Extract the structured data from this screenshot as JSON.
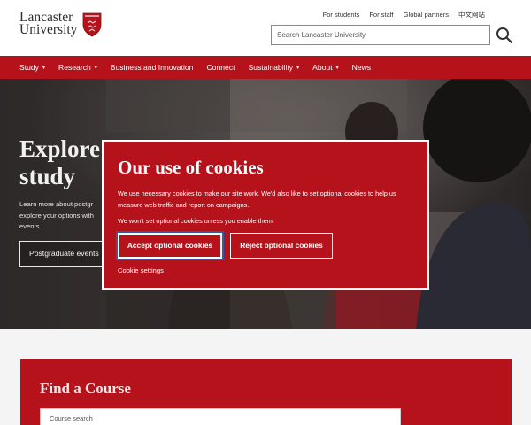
{
  "header": {
    "logo_line1": "Lancaster",
    "logo_line2": "University",
    "utility_links": [
      "For students",
      "For staff",
      "Global partners",
      "中文网站"
    ],
    "search_placeholder": "Search Lancaster University",
    "search_icon": "search-icon"
  },
  "nav": {
    "items": [
      {
        "label": "Study",
        "has_dropdown": true
      },
      {
        "label": "Research",
        "has_dropdown": true
      },
      {
        "label": "Business and Innovation",
        "has_dropdown": false
      },
      {
        "label": "Connect",
        "has_dropdown": false
      },
      {
        "label": "Sustainability",
        "has_dropdown": true
      },
      {
        "label": "About",
        "has_dropdown": true
      },
      {
        "label": "News",
        "has_dropdown": false
      }
    ],
    "caret": "▾"
  },
  "hero": {
    "title_line1": "Explore",
    "title_line2": "study",
    "desc_line1": "Learn more about postgr",
    "desc_line2": "explore your options with",
    "desc_line3": "events.",
    "button_label": "Postgraduate events"
  },
  "cookie_banner": {
    "title": "Our use of cookies",
    "paragraph1_line1": "We use necessary cookies to make our site work. We'd also like to set optional cookies to help us",
    "paragraph1_line2": "measure web traffic and report on campaigns.",
    "paragraph2": "We won't set optional cookies unless you enable them.",
    "accept_label": "Accept optional cookies",
    "reject_label": "Reject optional cookies",
    "settings_link": "Cookie settings"
  },
  "find_course": {
    "title": "Find a Course",
    "search_placeholder": "Course search"
  },
  "colors": {
    "brand_red": "#b5121b",
    "focus_blue": "#2b5ea6",
    "header_bg": "#ffffff"
  }
}
